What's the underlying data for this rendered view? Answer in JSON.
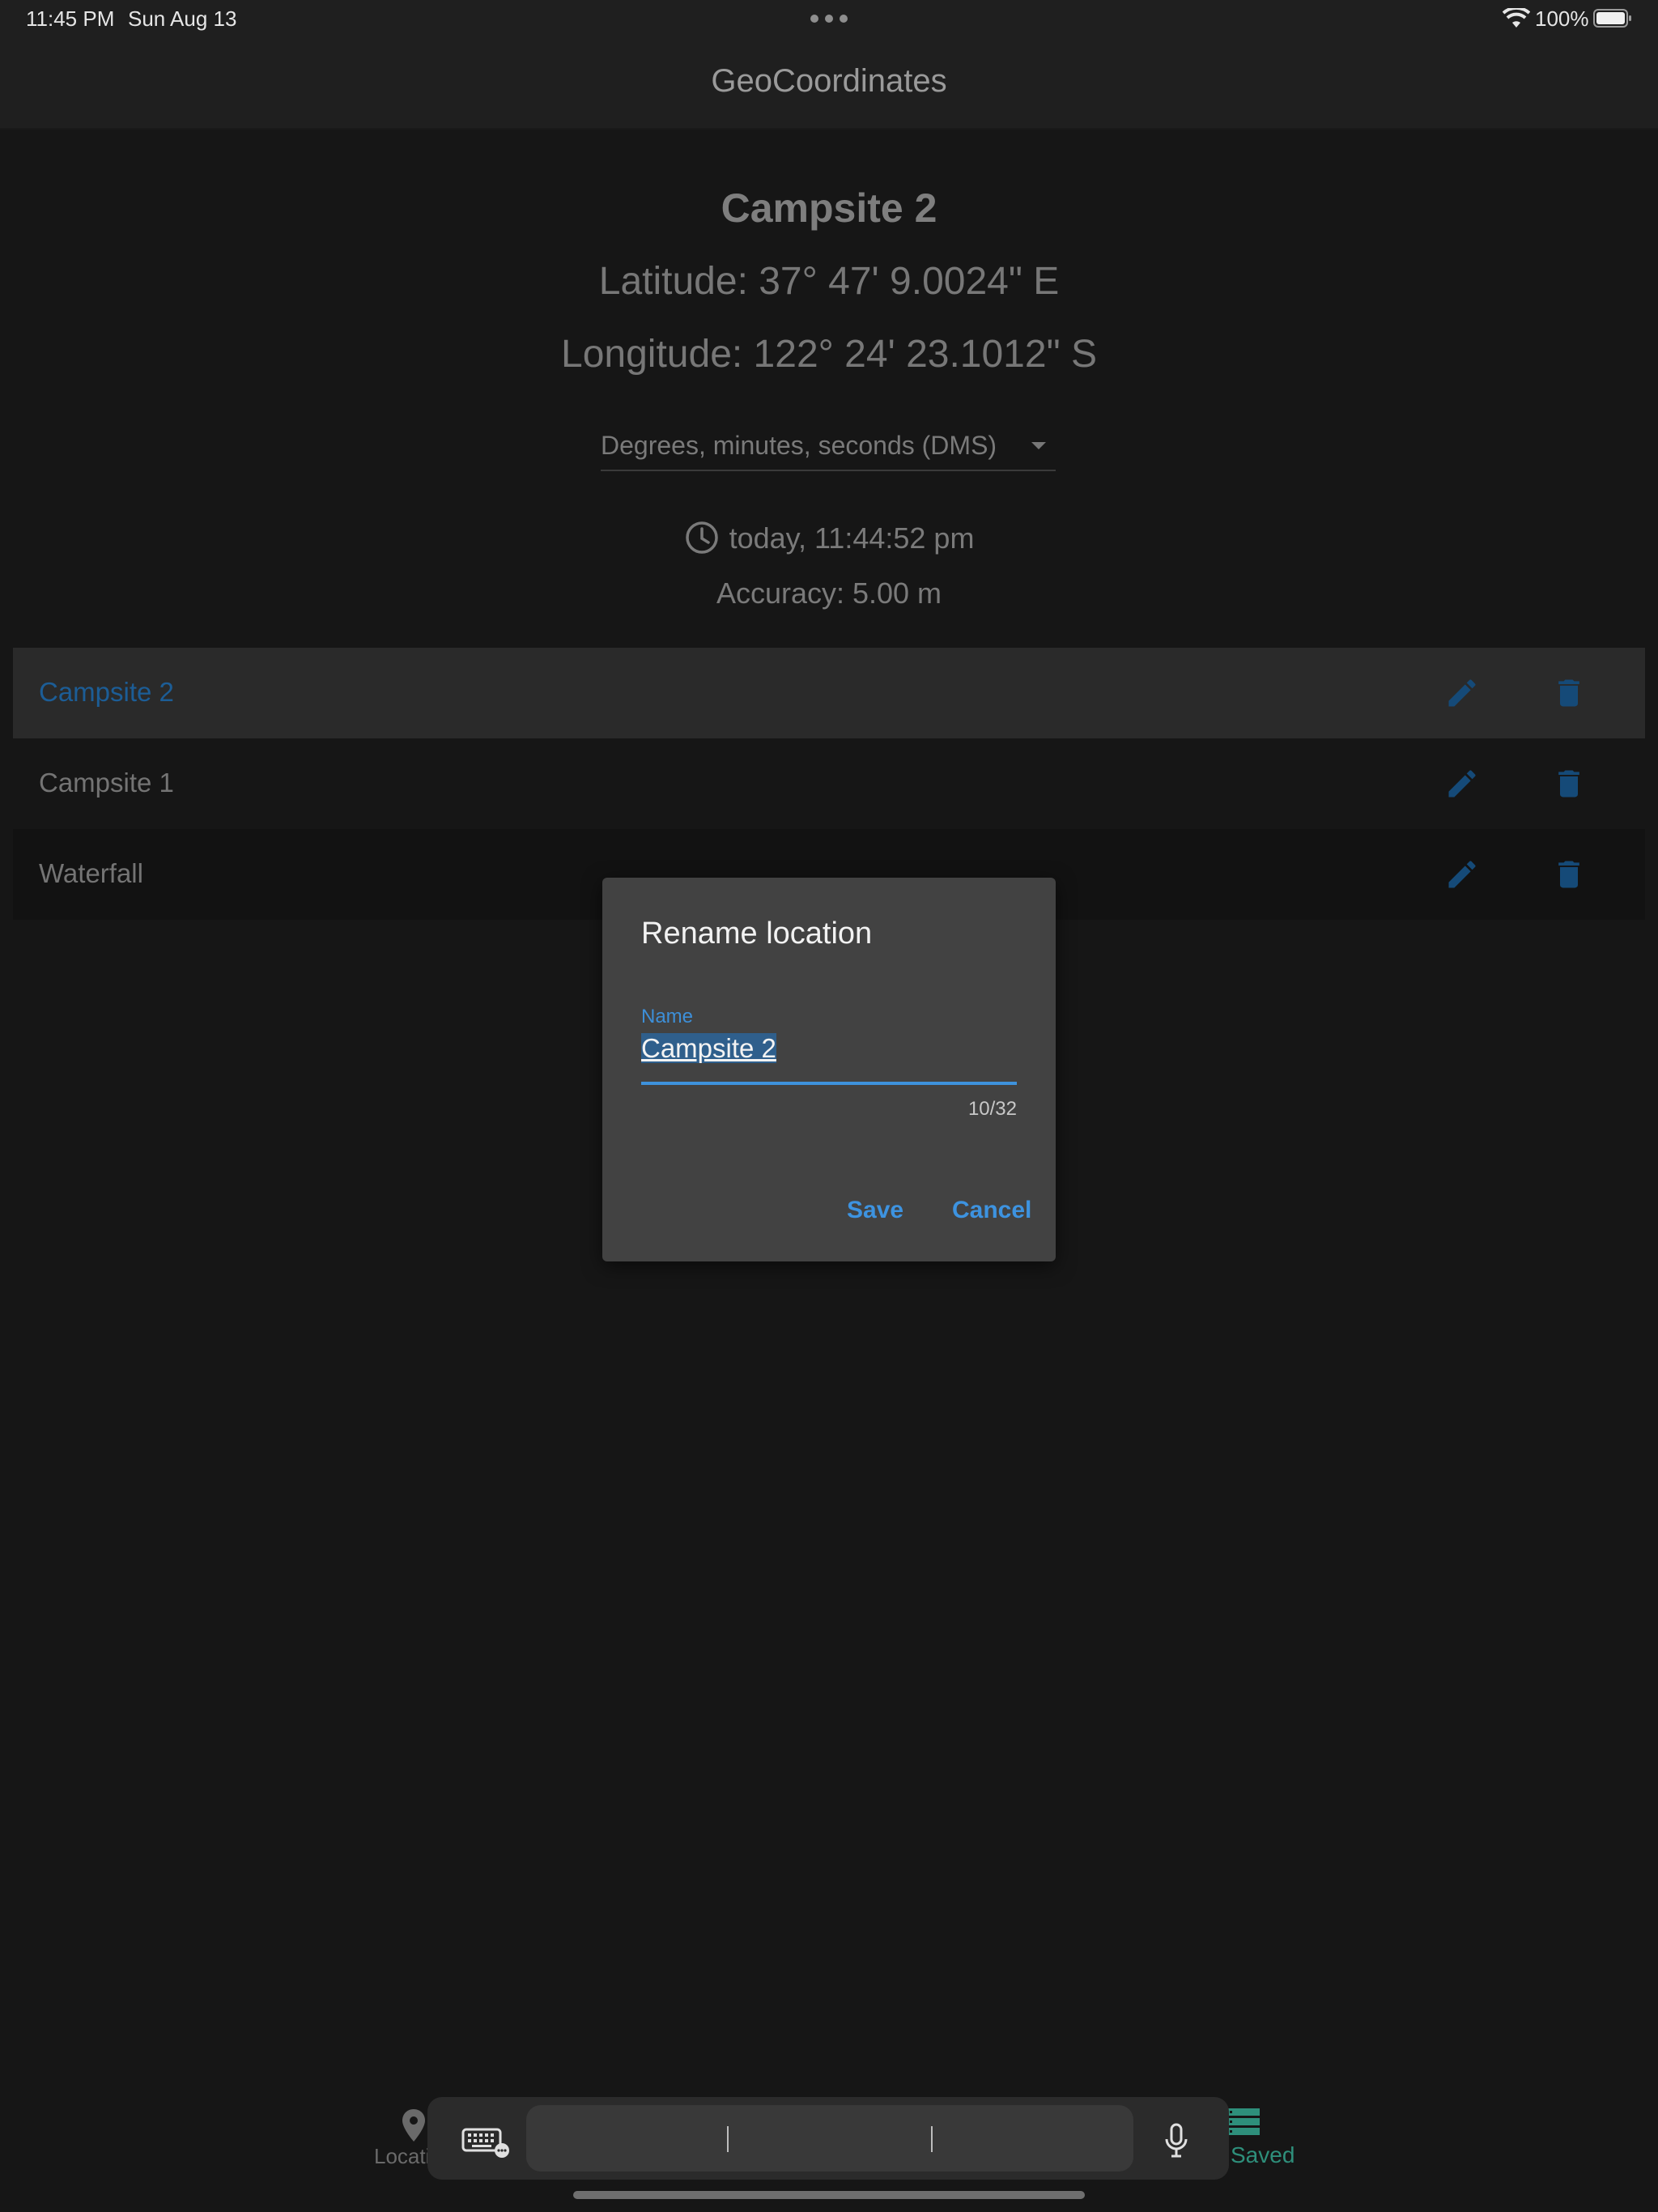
{
  "status_bar": {
    "time": "11:45 PM",
    "date": "Sun Aug 13",
    "battery": "100%"
  },
  "app_bar": {
    "title": "GeoCoordinates"
  },
  "detail": {
    "name": "Campsite 2",
    "latitude": "Latitude: 37° 47' 9.0024\" E",
    "longitude": "Longitude: 122° 24' 23.1012\" S",
    "format": "Degrees, minutes, seconds (DMS)",
    "timestamp": "today, 11:44:52 pm",
    "accuracy": "Accuracy: 5.00 m"
  },
  "saved_list": [
    {
      "label": "Campsite 2",
      "selected": true
    },
    {
      "label": "Campsite 1",
      "selected": false
    },
    {
      "label": "Waterfall",
      "selected": false
    }
  ],
  "dialog": {
    "title": "Rename location",
    "field_label": "Name",
    "field_value": "Campsite 2",
    "counter": "10/32",
    "save_label": "Save",
    "cancel_label": "Cancel"
  },
  "bottom_nav": {
    "location_label": "Location",
    "saved_label": "Saved"
  },
  "colors": {
    "accent": "#3d93e0",
    "selected_row_text": "#1c5d96",
    "saved_tab": "#2e8f7b",
    "background": "#161616",
    "dialog": "#424242"
  },
  "icons": [
    "wifi-icon",
    "battery-icon",
    "clock-icon",
    "edit-icon",
    "delete-icon",
    "location-pin-icon",
    "saved-list-icon",
    "keyboard-icon",
    "microphone-icon"
  ]
}
